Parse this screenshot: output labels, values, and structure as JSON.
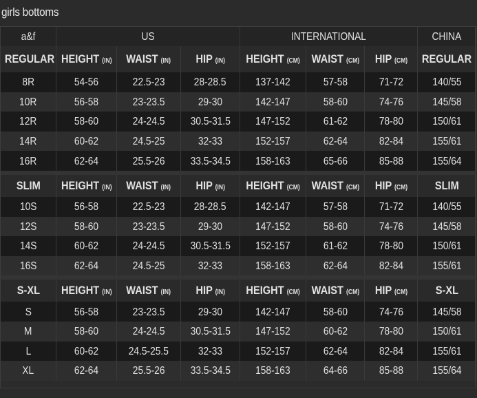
{
  "title": "girls bottoms",
  "top_header": [
    "a&f",
    "US",
    "INTERNATIONAL",
    "CHINA"
  ],
  "col_headers": {
    "height_in": "HEIGHT",
    "waist_in": "WAIST",
    "hip_in": "HIP",
    "unit_in": "(IN)",
    "height_cm": "HEIGHT",
    "waist_cm": "WAIST",
    "hip_cm": "HIP",
    "unit_cm": "(CM)"
  },
  "sections": [
    {
      "label": "REGULAR",
      "china_label": "REGULAR",
      "rows": [
        [
          "8R",
          "54-56",
          "22.5-23",
          "28-28.5",
          "137-142",
          "57-58",
          "71-72",
          "140/55"
        ],
        [
          "10R",
          "56-58",
          "23-23.5",
          "29-30",
          "142-147",
          "58-60",
          "74-76",
          "145/58"
        ],
        [
          "12R",
          "58-60",
          "24-24.5",
          "30.5-31.5",
          "147-152",
          "61-62",
          "78-80",
          "150/61"
        ],
        [
          "14R",
          "60-62",
          "24.5-25",
          "32-33",
          "152-157",
          "62-64",
          "82-84",
          "155/61"
        ],
        [
          "16R",
          "62-64",
          "25.5-26",
          "33.5-34.5",
          "158-163",
          "65-66",
          "85-88",
          "155/64"
        ]
      ]
    },
    {
      "label": "SLIM",
      "china_label": "SLIM",
      "rows": [
        [
          "10S",
          "56-58",
          "22.5-23",
          "28-28.5",
          "142-147",
          "57-58",
          "71-72",
          "140/55"
        ],
        [
          "12S",
          "58-60",
          "23-23.5",
          "29-30",
          "147-152",
          "58-60",
          "74-76",
          "145/58"
        ],
        [
          "14S",
          "60-62",
          "24-24.5",
          "30.5-31.5",
          "152-157",
          "61-62",
          "78-80",
          "150/61"
        ],
        [
          "16S",
          "62-64",
          "24.5-25",
          "32-33",
          "158-163",
          "62-64",
          "82-84",
          "155/61"
        ]
      ]
    },
    {
      "label": "S-XL",
      "china_label": "S-XL",
      "rows": [
        [
          "S",
          "56-58",
          "23-23.5",
          "29-30",
          "142-147",
          "58-60",
          "74-76",
          "145/58"
        ],
        [
          "M",
          "58-60",
          "24-24.5",
          "30.5-31.5",
          "147-152",
          "60-62",
          "78-80",
          "150/61"
        ],
        [
          "L",
          "60-62",
          "24.5-25.5",
          "32-33",
          "152-157",
          "62-64",
          "82-84",
          "155/61"
        ],
        [
          "XL",
          "62-64",
          "25.5-26",
          "33.5-34.5",
          "158-163",
          "64-66",
          "85-88",
          "155/64"
        ]
      ]
    }
  ]
}
